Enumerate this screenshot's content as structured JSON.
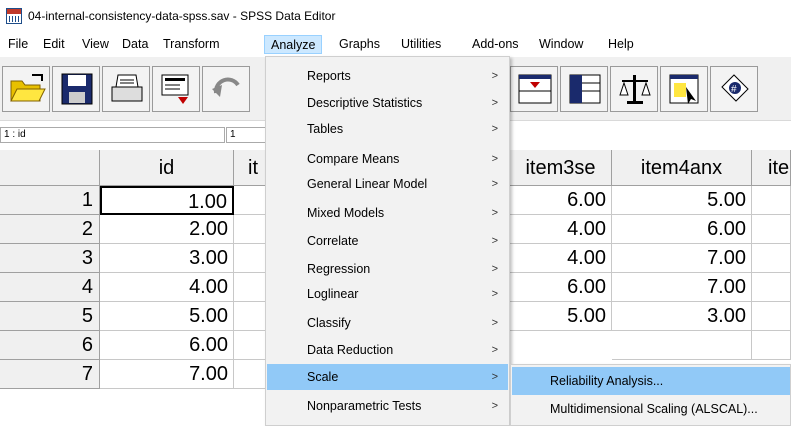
{
  "window": {
    "title": "04-internal-consistency-data-spss.sav - SPSS Data Editor"
  },
  "menubar": {
    "items": [
      "File",
      "Edit",
      "View",
      "Data",
      "Transform",
      "Analyze",
      "Graphs",
      "Utilities",
      "Add-ons",
      "Window",
      "Help"
    ],
    "active": "Analyze"
  },
  "toolbar": {
    "buttons": [
      "open-folder-icon",
      "save-disk-icon",
      "print-icon",
      "dialog-recall-icon",
      "undo-icon",
      "goto-variable-icon",
      "variables-icon",
      "weight-cases-icon",
      "select-cases-icon",
      "value-labels-icon"
    ]
  },
  "cellbar": {
    "ref": "1 : id",
    "value": "1"
  },
  "grid": {
    "columns": [
      "id",
      "it",
      "item3se",
      "item4anx",
      "ite"
    ],
    "rows": [
      {
        "num": "1",
        "id": "1.00",
        "item3se": "6.00",
        "item4anx": "5.00"
      },
      {
        "num": "2",
        "id": "2.00",
        "item3se": "4.00",
        "item4anx": "6.00"
      },
      {
        "num": "3",
        "id": "3.00",
        "item3se": "4.00",
        "item4anx": "7.00"
      },
      {
        "num": "4",
        "id": "4.00",
        "item3se": "6.00",
        "item4anx": "7.00"
      },
      {
        "num": "5",
        "id": "5.00",
        "item3se": "5.00",
        "item4anx": "3.00"
      },
      {
        "num": "6",
        "id": "6.00",
        "item3se": "",
        "item4anx": ""
      },
      {
        "num": "7",
        "id": "7.00",
        "item3se": "",
        "item4anx": ""
      }
    ]
  },
  "analyze_menu": {
    "items": [
      {
        "label": "Reports",
        "arrow": ">"
      },
      {
        "label": "Descriptive Statistics",
        "arrow": ">"
      },
      {
        "label": "Tables",
        "arrow": ">"
      },
      {
        "label": "Compare Means",
        "arrow": ">"
      },
      {
        "label": "General Linear Model",
        "arrow": ">"
      },
      {
        "label": "Mixed Models",
        "arrow": ">"
      },
      {
        "label": "Correlate",
        "arrow": ">"
      },
      {
        "label": "Regression",
        "arrow": ">"
      },
      {
        "label": "Loglinear",
        "arrow": ">"
      },
      {
        "label": "Classify",
        "arrow": ">"
      },
      {
        "label": "Data Reduction",
        "arrow": ">"
      },
      {
        "label": "Scale",
        "arrow": ">"
      },
      {
        "label": "Nonparametric Tests",
        "arrow": ">"
      }
    ],
    "highlighted": "Scale"
  },
  "scale_submenu": {
    "items": [
      "Reliability Analysis...",
      "Multidimensional Scaling (ALSCAL)..."
    ],
    "highlighted": "Reliability Analysis..."
  },
  "colors": {
    "menu_highlight": "#91c9f7",
    "menubar_active": "#cce8ff"
  }
}
